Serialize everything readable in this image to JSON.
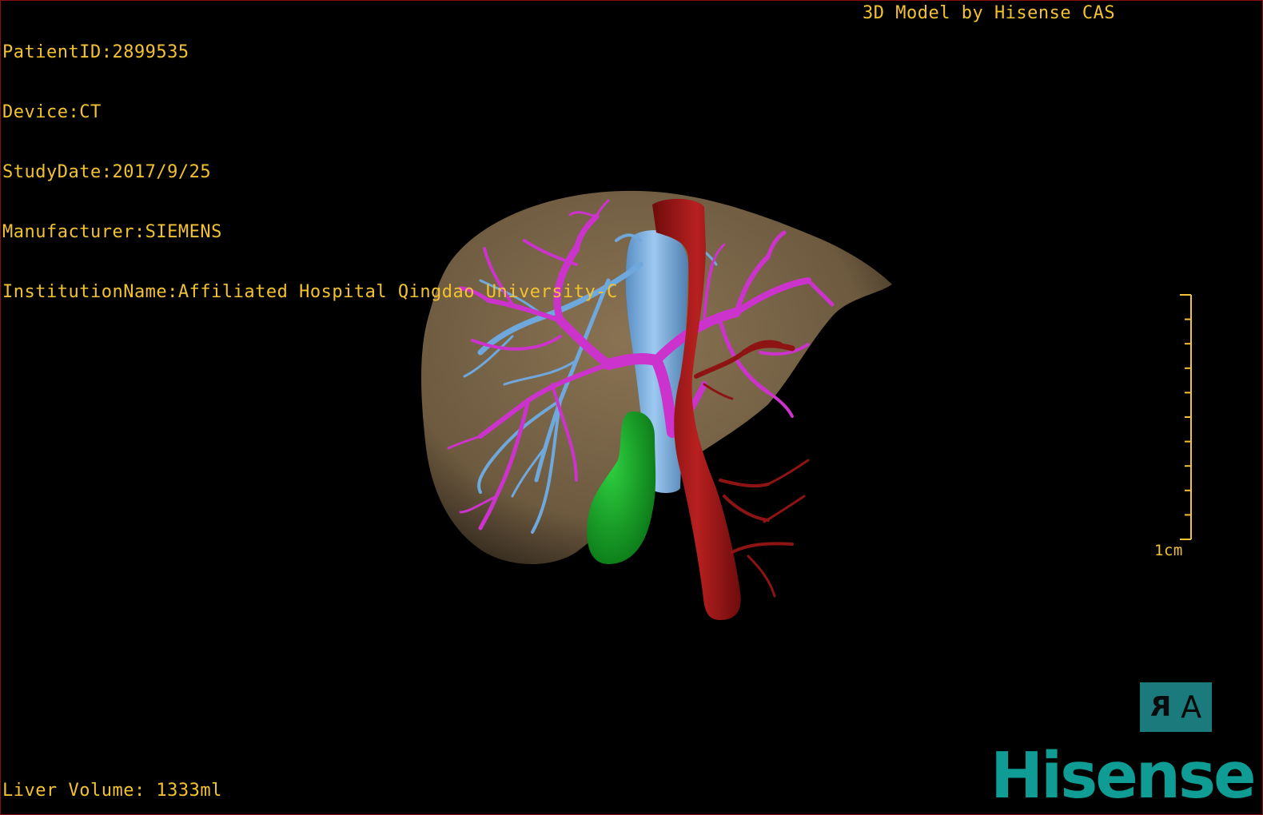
{
  "overlay": {
    "patient_id": "PatientID:2899535",
    "device": "Device:CT",
    "study_date": "StudyDate:2017/9/25",
    "manufacturer": "Manufacturer:SIEMENS",
    "institution": "InstitutionName:Affiliated Hospital Qingdao University-C",
    "model_credit": "3D Model by Hisense CAS",
    "liver_volume": "Liver Volume: 1333ml"
  },
  "scale_bar": {
    "label": "1cm",
    "ticks": 10
  },
  "orientation_cube": {
    "left_face": "R",
    "right_face": "A"
  },
  "logo": {
    "text": "Hisense"
  },
  "colors": {
    "overlay_text": "#f2c230",
    "liver": "#7a6447",
    "portal_vein": "#cc33cc",
    "hepatic_vein": "#6fa8dc",
    "ivc": "#7eb6e8",
    "aorta": "#a01818",
    "gallbladder": "#17a428",
    "logo": "#0f9c95",
    "cube": "#1a7a7c"
  }
}
